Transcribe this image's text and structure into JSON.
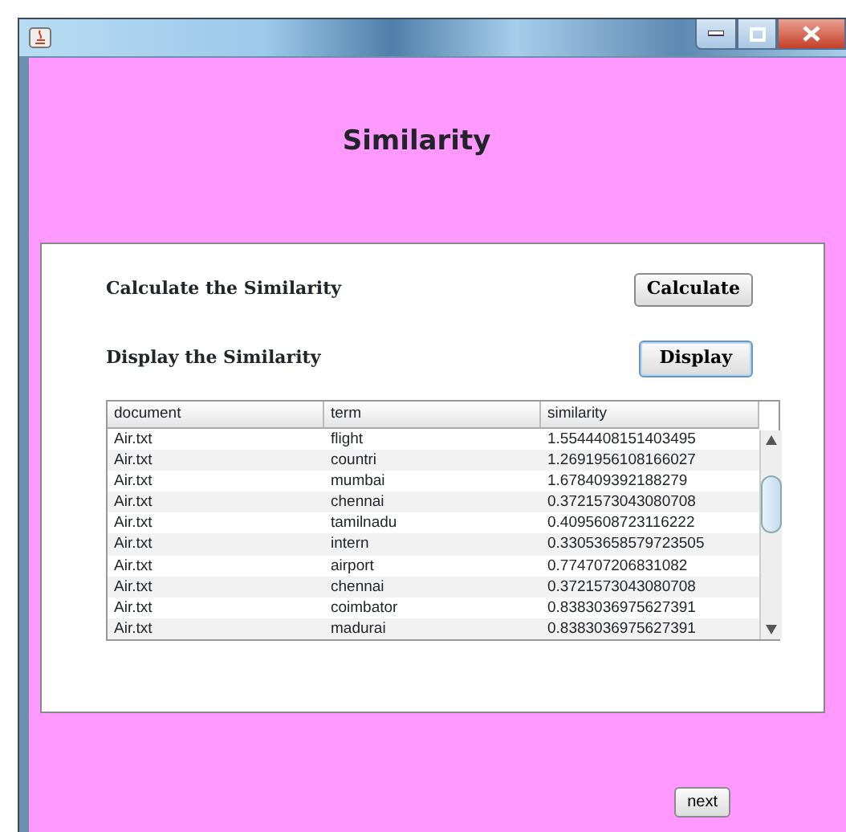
{
  "window": {
    "title": "Similarity"
  },
  "actions": [
    {
      "label": "Calculate the Similarity",
      "button": "Calculate",
      "focused": false
    },
    {
      "label": "Display the Similarity",
      "button": "Display",
      "focused": true
    }
  ],
  "table": {
    "columns": [
      "document",
      "term",
      "similarity"
    ],
    "rows": [
      [
        "Air.txt",
        "flight",
        "1.5544408151403495"
      ],
      [
        "Air.txt",
        "countri",
        "1.2691956108166027"
      ],
      [
        "Air.txt",
        "mumbai",
        "1.678409392188279"
      ],
      [
        "Air.txt",
        "chennai",
        "0.3721573043080708"
      ],
      [
        "Air.txt",
        "tamilnadu",
        "0.4095608723116222"
      ],
      [
        "Air.txt",
        "intern",
        "0.33053658579723505"
      ],
      [
        "Air.txt",
        "airport",
        "0.774707206831082"
      ],
      [
        "Air.txt",
        "chennai",
        "0.3721573043080708"
      ],
      [
        "Air.txt",
        "coimbator",
        "0.8383036975627391"
      ],
      [
        "Air.txt",
        "madurai",
        "0.8383036975627391"
      ]
    ]
  },
  "next_button": "next"
}
